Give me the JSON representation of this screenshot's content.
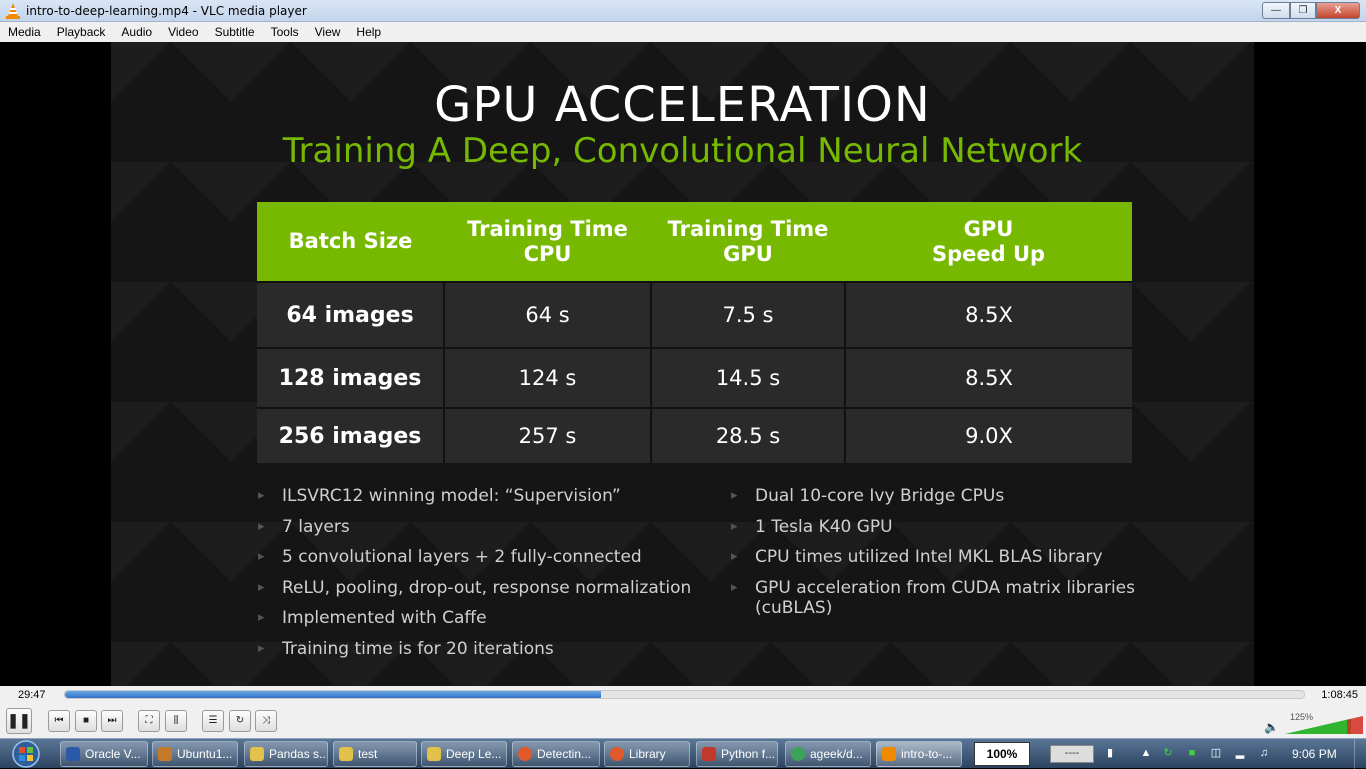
{
  "window": {
    "title": "intro-to-deep-learning.mp4 - VLC media player",
    "buttons": {
      "minimize": "—",
      "maximize": "❐",
      "close": "X"
    }
  },
  "menu": [
    "Media",
    "Playback",
    "Audio",
    "Video",
    "Subtitle",
    "Tools",
    "View",
    "Help"
  ],
  "slide": {
    "title": "GPU ACCELERATION",
    "subtitle": "Training A Deep, Convolutional Neural Network",
    "table": {
      "headers": [
        "Batch Size",
        "Training Time\nCPU",
        "Training Time\nGPU",
        "GPU\nSpeed Up"
      ],
      "rows": [
        [
          "64 images",
          "64 s",
          "7.5 s",
          "8.5X"
        ],
        [
          "128 images",
          "124 s",
          "14.5 s",
          "8.5X"
        ],
        [
          "256 images",
          "257 s",
          "28.5 s",
          "9.0X"
        ]
      ]
    },
    "bullets_left": [
      "ILSVRC12 winning model:  “Supervision”",
      "7 layers",
      "5 convolutional layers + 2 fully-connected",
      "ReLU, pooling, drop-out, response normalization",
      "Implemented  with Caffe",
      "Training time  is for 20 iterations"
    ],
    "bullets_right": [
      "Dual 10-core Ivy Bridge CPUs",
      "1 Tesla K40 GPU",
      "CPU times utilized Intel MKL BLAS library",
      "GPU acceleration from CUDA matrix libraries (cuBLAS)"
    ],
    "colors": {
      "accent": "#76b900",
      "background": "#151515",
      "cell": "#2a2a2a"
    }
  },
  "player": {
    "elapsed": "29:47",
    "total": "1:08:45",
    "progress_fraction": 0.433,
    "volume_label": "125%",
    "controls": [
      {
        "name": "pause-button",
        "icon": "❚❚"
      },
      {
        "name": "previous-button",
        "icon": "⏮"
      },
      {
        "name": "stop-button",
        "icon": "■"
      },
      {
        "name": "next-button",
        "icon": "⏭"
      },
      {
        "name": "fullscreen-button",
        "icon": "⛶"
      },
      {
        "name": "extended-settings-button",
        "icon": "⫼"
      },
      {
        "name": "playlist-button",
        "icon": "☰"
      },
      {
        "name": "loop-button",
        "icon": "↻"
      },
      {
        "name": "shuffle-button",
        "icon": "⤨"
      }
    ]
  },
  "taskbar": {
    "items": [
      {
        "label": "Oracle V...",
        "color": "#2a5aa8"
      },
      {
        "label": "Ubuntu1...",
        "color": "#c47a2a"
      },
      {
        "label": "Pandas s...",
        "color": "#e4c14a"
      },
      {
        "label": "test",
        "color": "#e4c14a"
      },
      {
        "label": "Deep Le...",
        "color": "#e4c14a"
      },
      {
        "label": "Detectin...",
        "color": "#e0592a"
      },
      {
        "label": "Library",
        "color": "#e0592a"
      },
      {
        "label": "Python f...",
        "color": "#c0392b"
      },
      {
        "label": "ageek/d...",
        "color": "#3aa357"
      },
      {
        "label": "intro-to-...",
        "color": "#f08a00"
      }
    ],
    "zoom": "100%",
    "tray_box": "----",
    "clock": "9:06 PM"
  }
}
